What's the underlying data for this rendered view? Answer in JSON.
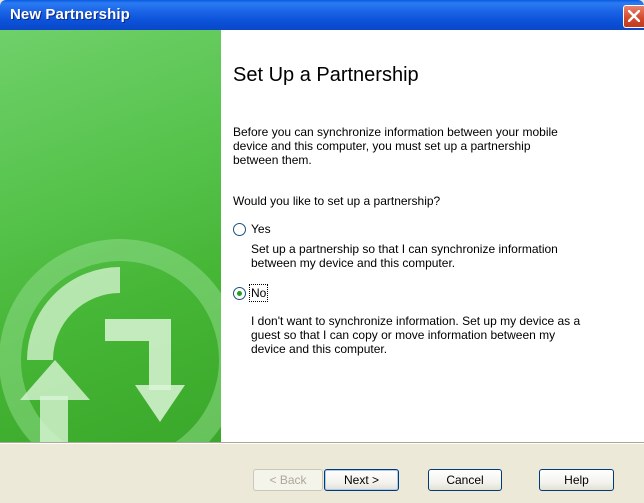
{
  "window": {
    "title": "New Partnership"
  },
  "main": {
    "heading": "Set Up a Partnership",
    "intro": "Before you can synchronize information between your mobile device and this computer, you must set up a partnership between them.",
    "question": "Would you like to set up a partnership?",
    "options": [
      {
        "label": "Yes",
        "description": "Set up a partnership so that I can synchronize information between my device and this computer.",
        "checked": false
      },
      {
        "label": "No",
        "description": "I don't want to synchronize information. Set up my device as a guest so that I can copy or move information between my device and this computer.",
        "checked": true
      }
    ]
  },
  "footer": {
    "back_label": "< Back",
    "next_label": "Next >",
    "cancel_label": "Cancel",
    "help_label": "Help"
  }
}
